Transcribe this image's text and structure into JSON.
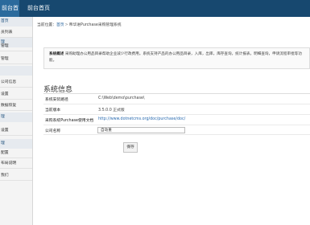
{
  "topbar": {
    "active_tab": "前台首页",
    "second_tab": "前台首页"
  },
  "sidebar": {
    "items": [
      {
        "label": "首页",
        "kind": "group"
      },
      {
        "label": "员列表",
        "kind": "sub"
      },
      {
        "label": "理",
        "kind": "group"
      },
      {
        "label": "管理",
        "kind": "sub"
      },
      {
        "label": "管理",
        "kind": "sub"
      },
      {
        "label": "",
        "kind": "group"
      },
      {
        "label": "公司信息",
        "kind": "sub"
      },
      {
        "label": "设置",
        "kind": "sub"
      },
      {
        "label": "数据恢复",
        "kind": "sub"
      },
      {
        "label": "理",
        "kind": "group"
      },
      {
        "label": "设置",
        "kind": "sub"
      },
      {
        "label": "理",
        "kind": "group"
      },
      {
        "label": "配置",
        "kind": "sub"
      },
      {
        "label": "布局说明",
        "kind": "sub"
      },
      {
        "label": "我们",
        "kind": "sub"
      }
    ]
  },
  "breadcrumb": {
    "prefix": "当前位置：",
    "home": "首页",
    "separator": ">",
    "current": "帝华进Purchase采购管理系统"
  },
  "notice": {
    "title": "系统概述",
    "text": "采购助理办公用品目录帮助企业减少行政费用。系统支持产品的办公用品目录，入库，出库，库存查询，统计报表，明细查询，申请流程审批等功能。"
  },
  "section": {
    "title": "系统信息"
  },
  "info": [
    {
      "label": "系统安装路径",
      "value": "C:\\Web\\demo\\purchase\\",
      "type": "text"
    },
    {
      "label": "当前版本",
      "value": "3.5.0.0 正式版",
      "type": "text"
    },
    {
      "label": "采购系统Purchase使用文档",
      "value": "http://www.dotnetcms.org/doc/purchase/doc/",
      "type": "link"
    }
  ],
  "company": {
    "label": "公司名称",
    "value": "自动重"
  },
  "save_button": "保存"
}
